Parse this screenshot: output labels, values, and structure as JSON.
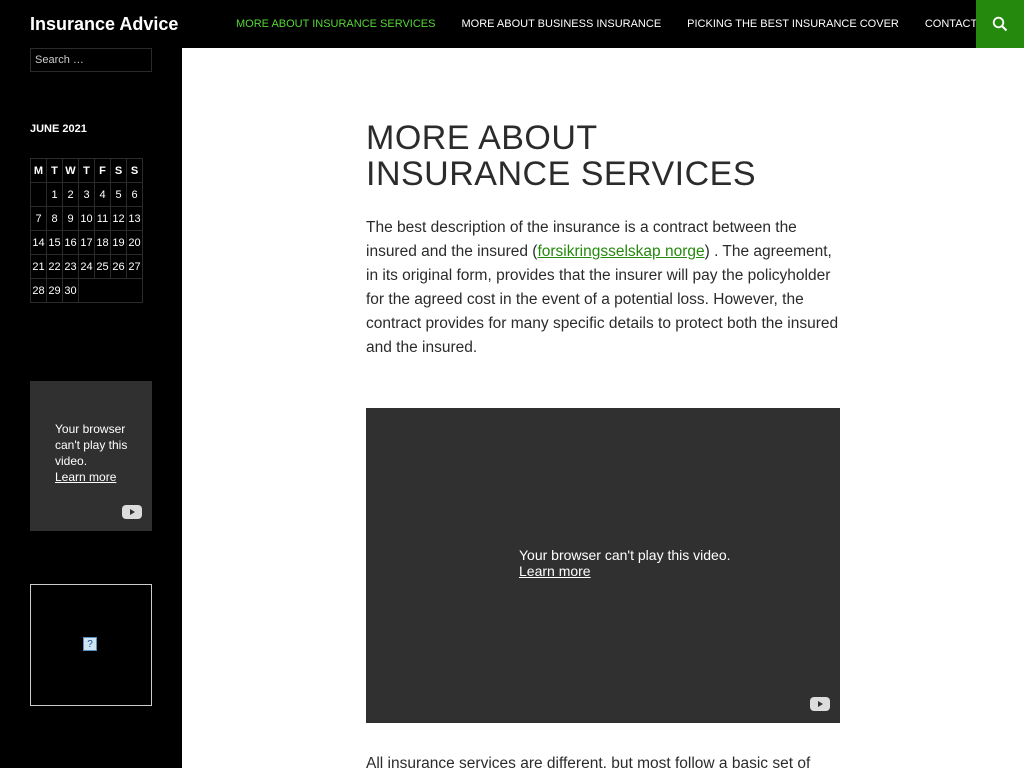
{
  "site": {
    "title": "Insurance Advice"
  },
  "nav": {
    "items": [
      {
        "label": "MORE ABOUT INSURANCE SERVICES",
        "active": true
      },
      {
        "label": "MORE ABOUT BUSINESS INSURANCE"
      },
      {
        "label": "PICKING THE BEST INSURANCE COVER"
      },
      {
        "label": "CONTACT US"
      }
    ],
    "search_icon": "search-icon"
  },
  "sidebar": {
    "search": {
      "placeholder": "Search …"
    },
    "calendar": {
      "title": "JUNE 2021",
      "days": [
        "M",
        "T",
        "W",
        "T",
        "F",
        "S",
        "S"
      ],
      "weeks": [
        [
          "",
          "1",
          "2",
          "3",
          "4",
          "5",
          "6"
        ],
        [
          "7",
          "8",
          "9",
          "10",
          "11",
          "12",
          "13"
        ],
        [
          "14",
          "15",
          "16",
          "17",
          "18",
          "19",
          "20"
        ],
        [
          "21",
          "22",
          "23",
          "24",
          "25",
          "26",
          "27"
        ],
        [
          "28",
          "29",
          "30",
          "",
          "",
          "",
          ""
        ]
      ]
    },
    "video": {
      "message": "Your browser can't play this video.",
      "link": "Learn more"
    }
  },
  "main": {
    "title": "MORE ABOUT INSURANCE SERVICES",
    "para1": {
      "before": "The best description of the insurance is a contract between the insured and the insured (",
      "link": "forsikringsselskap norge",
      "after": ") . The agreement, in its original form, provides that the insurer will pay the policyholder for the agreed cost in the event of a potential loss. However, the contract provides for many specific details to protect both the insured and the insured."
    },
    "video": {
      "message": "Your browser can't play this video.",
      "link": "Learn more"
    },
    "para2": "All insurance services are different, but most follow a basic set of"
  },
  "colors": {
    "accent": "#24890d",
    "nav_active": "#55d737",
    "bar": "#000000"
  }
}
